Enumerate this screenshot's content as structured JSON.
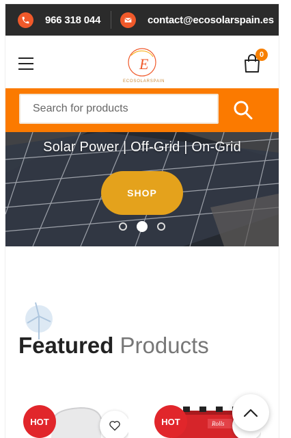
{
  "topbar": {
    "phone": "966 318 044",
    "email": "contact@ecosolarspain.es",
    "phone_icon": "phone-icon",
    "email_icon": "mail-icon"
  },
  "header": {
    "logo_letter": "E",
    "logo_text": "ECOSOLARSPAIN",
    "cart_count": "0",
    "cart_icon": "cart-bag-icon",
    "menu_icon": "hamburger-icon"
  },
  "search": {
    "placeholder": "Search for products",
    "icon": "search-icon"
  },
  "hero": {
    "title": "Solar Power | Off-Grid | On-Grid",
    "button_label": "SHOP",
    "slides_total": 3,
    "active_slide": 2
  },
  "featured": {
    "title_bold": "Featured",
    "title_light": "Products"
  },
  "products": [
    {
      "badge": "HOT",
      "wishlist_icon": "heart-icon"
    },
    {
      "badge": "HOT",
      "wishlist_icon": "heart-icon",
      "brand_text": "Rolls"
    }
  ],
  "colors": {
    "accent_orange": "#fb7a00",
    "topbar_bg": "#2b2b2b",
    "icon_orange": "#f0592a",
    "shop_button": "#e4a21c",
    "hot_badge": "#e1262b"
  }
}
